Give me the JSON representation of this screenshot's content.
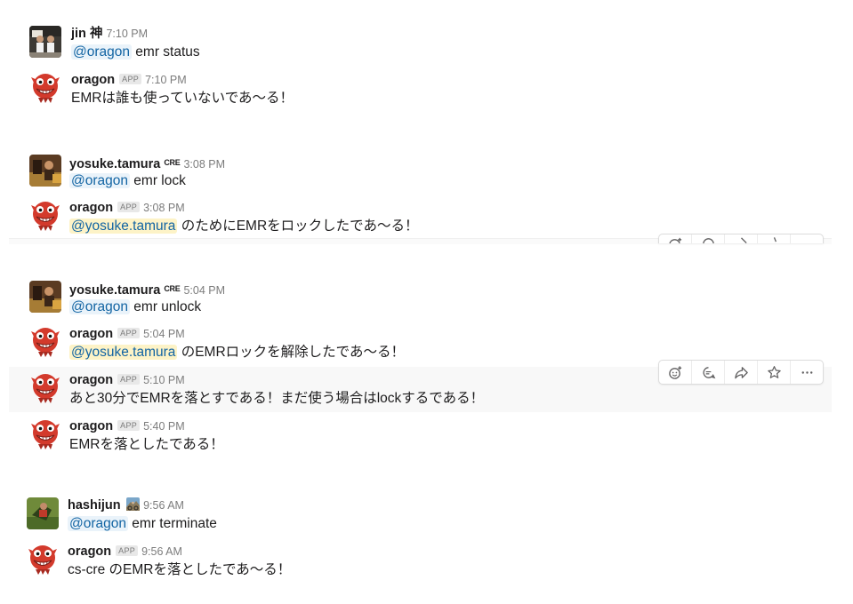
{
  "messages": [
    {
      "name": "jin 神",
      "time": "7:10 PM",
      "mention": "@oragon",
      "text": " emr status"
    },
    {
      "name": "oragon",
      "badge": "APP",
      "time": "7:10 PM",
      "text": "EMRは誰も使っていないであ〜る！"
    },
    {
      "name": "yosuke.tamura",
      "tag": "CRE",
      "time": "3:08 PM",
      "mention": "@oragon",
      "text": " emr lock"
    },
    {
      "name": "oragon",
      "badge": "APP",
      "time": "3:08 PM",
      "mention": "@yosuke.tamura",
      "text": " のためにEMRをロックしたであ〜る！"
    },
    {
      "name": "yosuke.tamura",
      "tag": "CRE",
      "time": "5:04 PM",
      "mention": "@oragon",
      "text": " emr unlock"
    },
    {
      "name": "oragon",
      "badge": "APP",
      "time": "5:04 PM",
      "mention": "@yosuke.tamura",
      "text": " のEMRロックを解除したであ〜る！"
    },
    {
      "name": "oragon",
      "badge": "APP",
      "time": "5:10 PM",
      "text": "あと30分でEMRを落とすである！まだ使う場合はlockするである！"
    },
    {
      "name": "oragon",
      "badge": "APP",
      "time": "5:40 PM",
      "text": "EMRを落としたである！"
    },
    {
      "name": "hashijun",
      "time": "9:56 AM",
      "mention": "@oragon",
      "text": " emr terminate"
    },
    {
      "name": "oragon",
      "badge": "APP",
      "time": "9:56 AM",
      "text": "cs-cre のEMRを落としたであ〜る！"
    }
  ],
  "icons": {
    "actions": [
      "add-reaction-icon",
      "reply-thread-icon",
      "share-message-icon",
      "star-icon",
      "more-actions-icon"
    ],
    "name_emoji": "mountain-bike-emoji-icon"
  },
  "colors": {
    "mention": "#1264a3",
    "mention_bg": "#eaf3fa",
    "self_mention_bg": "#fdf3c7",
    "hover_row_bg": "#f8f8f8",
    "oragon_red": "#d33a2c"
  }
}
